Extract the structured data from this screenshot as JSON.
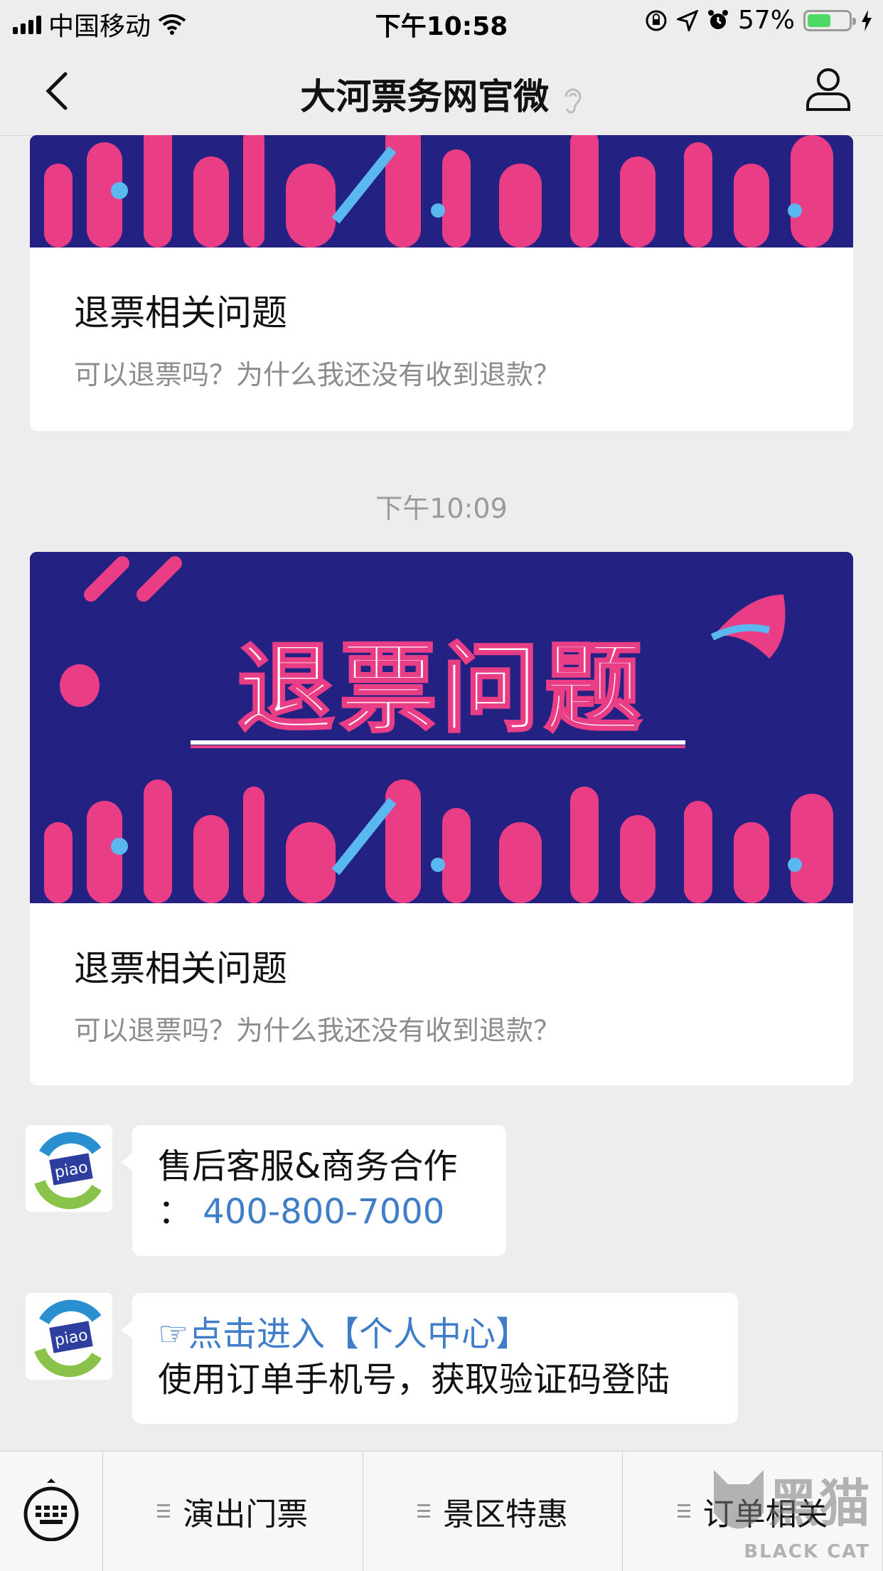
{
  "status_bar": {
    "carrier": "中国移动",
    "time": "下午10:58",
    "battery_percent": "57%",
    "battery_level": 0.57
  },
  "nav": {
    "title": "大河票务网官微",
    "back_icon": "chevron-left-icon",
    "profile_icon": "person-icon",
    "ear_icon": "ear-icon"
  },
  "cards": [
    {
      "title": "退票相关问题",
      "description": "可以退票吗？为什么我还没有收到退款？"
    },
    {
      "banner_text": "退票问题",
      "title": "退票相关问题",
      "description": "可以退票吗？为什么我还没有收到退款？"
    }
  ],
  "timestamp": "下午10:09",
  "messages": [
    {
      "avatar_text": "piao",
      "line1": "售后客服&商务合作",
      "colon": "：",
      "phone": "400-800-7000"
    },
    {
      "avatar_text": "piao",
      "pointer": "☞",
      "link_text": "点击进入【个人中心】",
      "line2": "使用订单手机号，获取验证码登陆"
    }
  ],
  "bottom_menu": {
    "keyboard_icon": "keyboard-icon",
    "items": [
      "演出门票",
      "景区特惠",
      "订单相关"
    ]
  },
  "watermark": {
    "cn": "黑猫",
    "en": "BLACK CAT"
  },
  "colors": {
    "banner_bg": "#232181",
    "banner_pink": "#e93d86",
    "link": "#3f7dc8",
    "battery": "#4cd964"
  }
}
